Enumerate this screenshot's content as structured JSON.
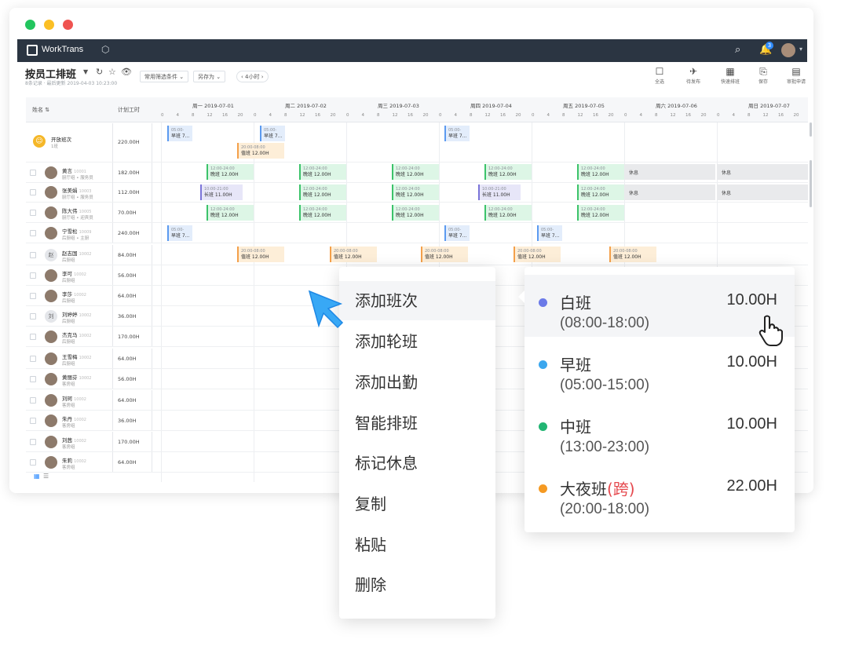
{
  "window": {
    "dot_colors": [
      "#22c55e",
      "#fbbf24",
      "#ef5350"
    ]
  },
  "appbar": {
    "brand": "WorkTrans",
    "notification_badge": "3"
  },
  "toolbar": {
    "title": "按员工排班",
    "subtitle": "8条记录 · 最后更新 2019-04-03 10:23:00",
    "filter_label": "常用筛选条件",
    "save_as_label": "另存为",
    "range_label": "4小时",
    "buttons": [
      {
        "label": "全选",
        "icon": "square-icon"
      },
      {
        "label": "待发布",
        "icon": "send-icon"
      },
      {
        "label": "快速排班",
        "icon": "calendar-icon"
      },
      {
        "label": "保存",
        "icon": "save-icon"
      },
      {
        "label": "审批申请",
        "icon": "document-icon"
      }
    ]
  },
  "grid": {
    "col_name": "姓名",
    "col_hours": "计划工时",
    "days": [
      {
        "label": "周一  2019-07-01"
      },
      {
        "label": "周二  2019-07-02"
      },
      {
        "label": "周三  2019-07-03"
      },
      {
        "label": "周四  2019-07-04"
      },
      {
        "label": "周五  2019-07-05"
      },
      {
        "label": "周六  2019-07-06"
      },
      {
        "label": "周日  2019-07-07"
      }
    ],
    "ticks": [
      "0",
      "4",
      "8",
      "12",
      "16",
      "20"
    ],
    "open_row": {
      "name": "开放班次",
      "sub": "1班",
      "hours": "220.00H"
    },
    "employees": [
      {
        "name": "黄言",
        "id": "10001",
        "dept": "厨厅组 • 服务员",
        "hours": "182.00H"
      },
      {
        "name": "张美娟",
        "id": "10003",
        "dept": "厨厅组 • 服务员",
        "hours": "112.00H"
      },
      {
        "name": "陈大伟",
        "id": "10005",
        "dept": "厨厅组 • 迎宾员",
        "hours": "70.00H"
      },
      {
        "name": "宁雪松",
        "id": "10009",
        "dept": "后厨组 • 主厨",
        "hours": "240.00H"
      },
      {
        "name": "赵志国",
        "id": "10002",
        "dept": "后厨组",
        "hours": "84.00H",
        "avatar_text": "赵"
      },
      {
        "name": "李可",
        "id": "10002",
        "dept": "后厨组",
        "hours": "56.00H"
      },
      {
        "name": "李莎",
        "id": "10002",
        "dept": "后厨组",
        "hours": "64.00H"
      },
      {
        "name": "刘婷婷",
        "id": "10002",
        "dept": "后厨组",
        "hours": "36.00H",
        "avatar_text": "刘"
      },
      {
        "name": "杰克马",
        "id": "10002",
        "dept": "后厨组",
        "hours": "170.00H"
      },
      {
        "name": "王雪梅",
        "id": "10002",
        "dept": "后厨组",
        "hours": "64.00H"
      },
      {
        "name": "黄丽芬",
        "id": "10002",
        "dept": "客房组",
        "hours": "56.00H"
      },
      {
        "name": "刘珂",
        "id": "10002",
        "dept": "客房组",
        "hours": "64.00H"
      },
      {
        "name": "朱丹",
        "id": "10002",
        "dept": "客房组",
        "hours": "36.00H"
      },
      {
        "name": "刘茜",
        "id": "10002",
        "dept": "客房组",
        "hours": "170.00H"
      },
      {
        "name": "朱莉",
        "id": "10002",
        "dept": "客房组",
        "hours": "64.00H"
      }
    ],
    "shift_labels": {
      "early": "早班 7...",
      "early_time": "05:00-",
      "night": "值班 12.00H",
      "night_time": "20:00-08:00",
      "late": "晚班 12.00H",
      "late_time": "12:00-24:00",
      "long": "长班 11.00H",
      "long_time": "10:00-21:00",
      "rest": "休息"
    }
  },
  "context_menu": {
    "items": [
      "添加班次",
      "添加轮班",
      "添加出勤",
      "智能排班",
      "标记休息",
      "复制",
      "粘贴",
      "删除"
    ]
  },
  "shift_menu": {
    "items": [
      {
        "name": "白班",
        "time": "(08:00-18:00)",
        "hours": "10.00H",
        "color": "#6b7ae8"
      },
      {
        "name": "早班",
        "time": "(05:00-15:00)",
        "hours": "10.00H",
        "color": "#3ba7ee"
      },
      {
        "name": "中班",
        "time": "(13:00-23:00)",
        "hours": "10.00H",
        "color": "#22b573"
      },
      {
        "name": "大夜班",
        "cross": "(跨)",
        "time": "(20:00-18:00)",
        "hours": "22.00H",
        "color": "#f59a23"
      }
    ]
  }
}
